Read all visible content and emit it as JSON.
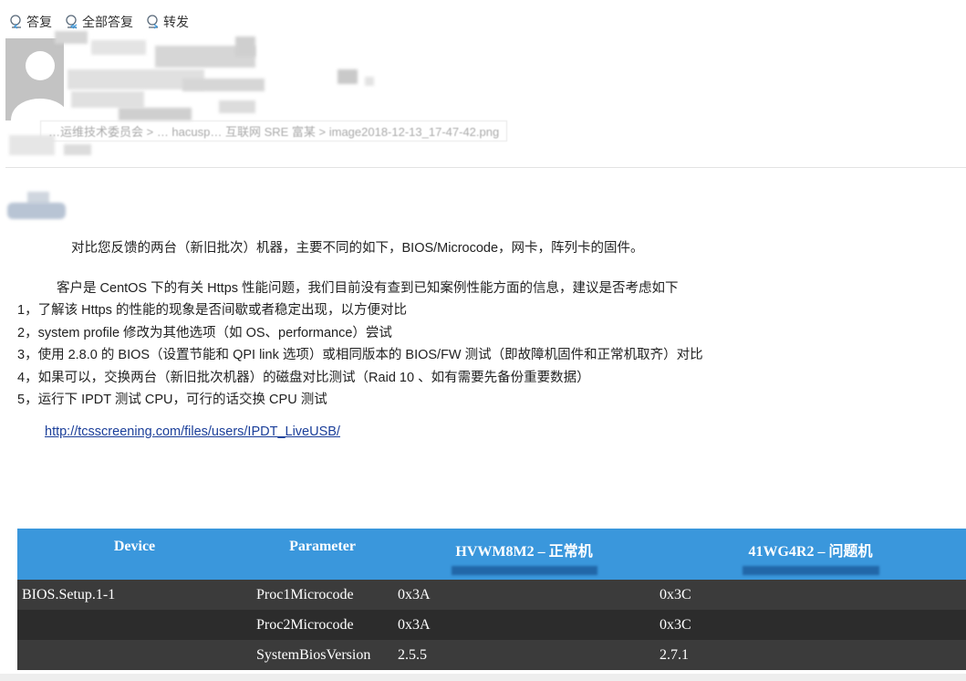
{
  "toolbar": {
    "reply": "答复",
    "reply_all": "全部答复",
    "forward": "转发"
  },
  "header": {
    "blurred_line": "…运维技术委员会 > … hacusp… 互联网 SRE 富某 > image2018-12-13_17-47-42.png"
  },
  "body": {
    "p1": "对比您反馈的两台（新旧批次）机器，主要不同的如下，BIOS/Microcode，网卡，阵列卡的固件。",
    "p2": "客户是 CentOS 下的有关 Https 性能问题，我们目前没有查到已知案例性能方面的信息，建议是否考虑如下",
    "items": [
      "1，了解该 Https 的性能的现象是否间歇或者稳定出现，以方便对比",
      "2，system profile 修改为其他选项（如 OS、performance）尝试",
      "3，使用 2.8.0 的 BIOS（设置节能和 QPI link 选项）或相同版本的 BIOS/FW 测试（即故障机固件和正常机取齐）对比",
      "4，如果可以，交换两台（新旧批次机器）的磁盘对比测试（Raid 10 、如有需要先备份重要数据）",
      "5，运行下 IPDT 测试 CPU，可行的话交换 CPU 测试"
    ],
    "link": "http://tcsscreening.com/files/users/IPDT_LiveUSB/"
  },
  "table": {
    "headers": [
      "Device",
      "Parameter",
      "HVWM8M2 – 正常机",
      "41WG4R2 – 问题机"
    ],
    "rows": [
      [
        "BIOS.Setup.1-1",
        "Proc1Microcode",
        "0x3A",
        "0x3C"
      ],
      [
        "",
        "Proc2Microcode",
        "0x3A",
        "0x3C"
      ],
      [
        "",
        "SystemBiosVersion",
        "2.5.5",
        "2.7.1"
      ]
    ],
    "header_color": "#3a97dc",
    "row_color": "#333333"
  }
}
